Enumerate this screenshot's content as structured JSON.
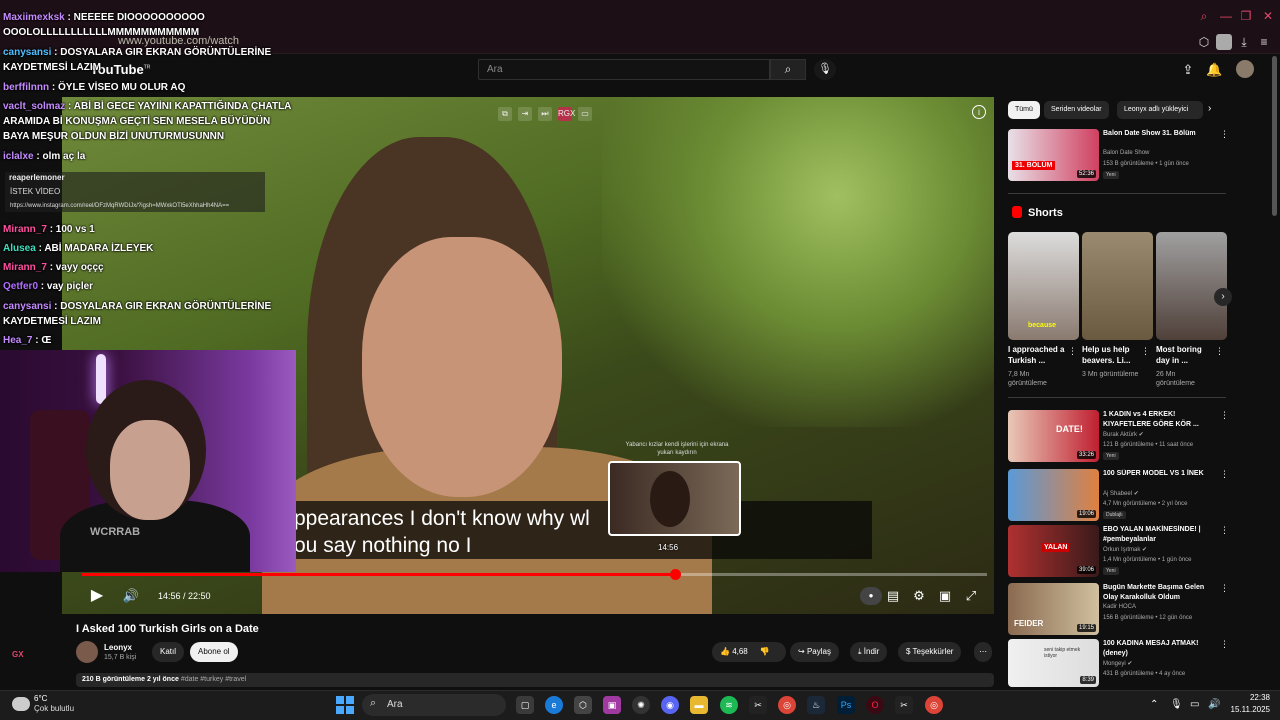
{
  "browser": {
    "url": "www.youtube.com/watch",
    "colors": {
      "accent": "#e0476b"
    }
  },
  "youtube": {
    "logo": "YouTube",
    "logo_superscript": "TR",
    "search_placeholder": "Ara"
  },
  "player": {
    "caption_line1": "ppearances I don't know why wl",
    "caption_line2": "ou say nothing no I",
    "preview_title": "Yabancı kızlar kendi işlerini için ekrana yukarı kaydırın",
    "preview_time": "14:56",
    "time_display": "14:56 / 22:50",
    "progress_fraction": 0.655,
    "top_badge": "RGX"
  },
  "video": {
    "title": "I Asked 100 Turkish Girls on a Date",
    "channel": "Leonyx",
    "subscribers": "15,7 B kişi",
    "join": "Katıl",
    "subscribe": "Abone ol",
    "likes": "4,68",
    "share": "Paylaş",
    "download": "İndir",
    "thanks": "Teşekkürler",
    "views_age": "210 B görüntüleme  2 yıl önce",
    "tags": "#date #turkey #travel"
  },
  "sidebar": {
    "chips": [
      "Tümü",
      "Seriden videolar",
      "Leonyx adlı yükleyici"
    ],
    "shorts_label": "Shorts",
    "top_rec": {
      "title": "Balon Date Show 31. Bölüm",
      "channel": "Balon Date Show",
      "meta": "153 B görüntüleme • 1 gün önce",
      "badge": "Yeni",
      "duration": "52:36",
      "thumb_text": "31. BÖLÜM"
    },
    "shorts": [
      {
        "title": "I approached a Turkish ...",
        "views": "7,8 Mn görüntüleme",
        "overlay": "because"
      },
      {
        "title": "Help us help beavers. Li...",
        "views": "3 Mn görüntüleme",
        "overlay": ""
      },
      {
        "title": "Most boring day in ...",
        "views": "26 Mn görüntüleme",
        "overlay": ""
      }
    ],
    "recs": [
      {
        "title": "1 KADIN vs 4 ERKEK! KIYAFETLERE GÖRE KÖR ...",
        "channel": "Burak Aktürk ✔",
        "meta": "121 B görüntüleme • 11 saat önce",
        "badge": "Yeni",
        "duration": "33:26",
        "thumb_text": "DATE!"
      },
      {
        "title": "100 SÜPER MODEL VS 1 İNEK",
        "channel": "Aj Shabeel ✔",
        "meta": "4,7 Mn görüntüleme • 2 yıl önce",
        "badge": "Dublajlı",
        "duration": "19:06",
        "thumb_text": ""
      },
      {
        "title": "EBO YALAN MAKİNESİNDE! | #pembeyalanlar",
        "channel": "Orkun Işıtmak ✔",
        "meta": "1,4 Mn görüntüleme • 1 gün önce",
        "badge": "Yeni",
        "duration": "39:06",
        "thumb_text": "YALAN"
      },
      {
        "title": "Bugün Markette Başıma Gelen Olay Karakolluk Oldum",
        "channel": "Kadir HOCA",
        "meta": "156 B görüntüleme • 12 gün önce",
        "badge": "",
        "duration": "19:15",
        "thumb_text": "FEIDER"
      },
      {
        "title": "100 KADINA MESAJ ATMAK! (deney)",
        "channel": "Mongeyi ✔",
        "meta": "431 B görüntüleme • 4 ay önce",
        "badge": "",
        "duration": "8:39",
        "thumb_text": "seni takip etmek istiyor"
      }
    ]
  },
  "chat": {
    "messages": [
      {
        "user": "Maxiimexksk",
        "text": ": NEEEEE DIOOOOOOOOOO OOOLOLLLLLLLLLLLMMMMMMMMMMM"
      },
      {
        "user": "canysansi",
        "text": ": DOSYALARA GIR EKRAN GÖRÜNTÜLERİNE KAYDETMESİ LAZIM"
      },
      {
        "user": "berffilnnn",
        "text": ": ÖYLE VİSEO MU OLUR AQ"
      },
      {
        "user": "vaclt_solmaz",
        "text": ": ABİ Bİ GECE YAYIİNI KAPATTIĞINDA ÇHATLA ARAMIDA Bİ KONUŞMA GEÇTİ SEN MESELA BÜYÜDÜN BAYA MEŞUR OLDUN BİZİ UNUTURMUSUNNN"
      },
      {
        "user": "iclalxe",
        "text": ": olm aç la"
      },
      {
        "user": "Mirann_7",
        "text": ": 100 vs 1"
      },
      {
        "user": "Alusea",
        "text": ": ABİ MADARA İZLEYEK"
      },
      {
        "user": "Mirann_7",
        "text": ": vayy oççç"
      },
      {
        "user": "Qetfer0",
        "text": ": vay piçler"
      },
      {
        "user": "canysansi",
        "text": ": DOSYALARA GIR EKRAN GÖRÜNTÜLERİNE KAYDETMESİ LAZIM"
      },
      {
        "user": "Hea_7",
        "text": ": Œ"
      }
    ],
    "request": {
      "user": "reaperlemoner",
      "label": "İSTEK VİDEO",
      "link": "https://www.instagram.com/reel/DFzMqRWDIJx/?igsh=MWxkOTl5eXhhaHh4NA=="
    },
    "webcam_text": "WCRRAB"
  },
  "taskbar": {
    "weather_temp": "6°C",
    "weather_desc": "Çok bulutlu",
    "search": "Ara",
    "time": "22:38",
    "date": "15.11.2025",
    "gx": "GX"
  }
}
